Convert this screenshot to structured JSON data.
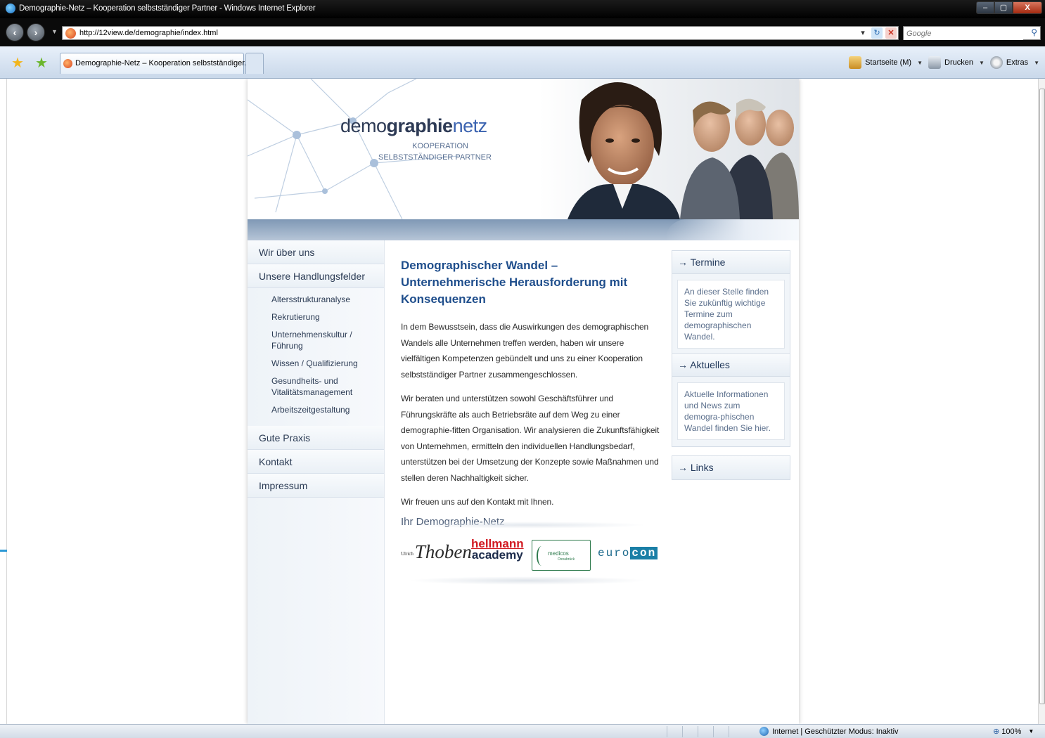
{
  "window": {
    "title": "Demographie-Netz – Kooperation selbstständiger Partner - Windows Internet Explorer",
    "buttons": {
      "minimize": "–",
      "maximize": "▢",
      "close": "X"
    }
  },
  "address": {
    "url": "http://12view.de/demographie/index.html",
    "search_placeholder": "Google"
  },
  "tabs": [
    {
      "label": "Demographie-Netz – Kooperation selbstständiger..."
    }
  ],
  "command_bar": {
    "home": "Startseite (M)",
    "print": "Drucken",
    "tools": "Extras"
  },
  "header": {
    "brand_part1": "demo",
    "brand_part2": "graphie",
    "brand_part3": "netz",
    "tagline1": "KOOPERATION",
    "tagline2": "SELBSTSTÄNDIGER PARTNER"
  },
  "nav": {
    "main": [
      "Wir über uns",
      "Unsere Handlungsfelder",
      "Gute Praxis",
      "Kontakt",
      "Impressum"
    ],
    "sub": [
      "Altersstrukturanalyse",
      "Rekrutierung",
      "Unternehmenskultur / Führung",
      "Wissen / Qualifizierung",
      "Gesundheits- und Vitalitätsmanagement",
      "Arbeitszeitgestaltung"
    ]
  },
  "content": {
    "headline": "Demographischer Wandel – Unternehmerische Herausforderung mit Konsequenzen",
    "para1": "In dem Bewusstsein, dass die Auswirkungen des demographischen Wandels alle Unternehmen treffen werden, haben wir unsere vielfältigen Kompetenzen gebündelt und uns zu einer Kooperation selbstständiger Partner zusammengeschlossen.",
    "para2": "Wir beraten und unterstützen sowohl Geschäftsführer und Führungskräfte als auch Betriebsräte auf dem Weg zu einer demographie-fitten Organisation. Wir analysieren die Zukunftsfähigkeit von Unternehmen, ermitteln den individuellen Handlungsbedarf, unterstützen bei der Umsetzung der Konzepte sowie Maßnahmen und stellen deren Nachhaltigkeit sicher.",
    "para3": "Wir freuen uns auf den Kontakt mit Ihnen.",
    "signature": "Ihr Demographie-Netz"
  },
  "logos": {
    "thoben_small": "Ulrich",
    "thoben": "Thoben",
    "hellmann1": "hellmann",
    "hellmann2": "academy",
    "medicos": "medicos",
    "medicos_sub": "Osnabrück",
    "euro": "euro",
    "con": "con"
  },
  "sidebar": {
    "termine_title": "→ Termine",
    "termine_text": "An dieser Stelle finden Sie zukünftig wichtige Termine zum demographischen Wandel.",
    "aktuelles_title": "→ Aktuelles",
    "aktuelles_text": "Aktuelle Informationen und News zum demogra-phischen Wandel finden Sie hier.",
    "links_title": "→ Links"
  },
  "status": {
    "zone": "Internet | Geschützter Modus: Inaktiv",
    "zoom": "100%"
  }
}
